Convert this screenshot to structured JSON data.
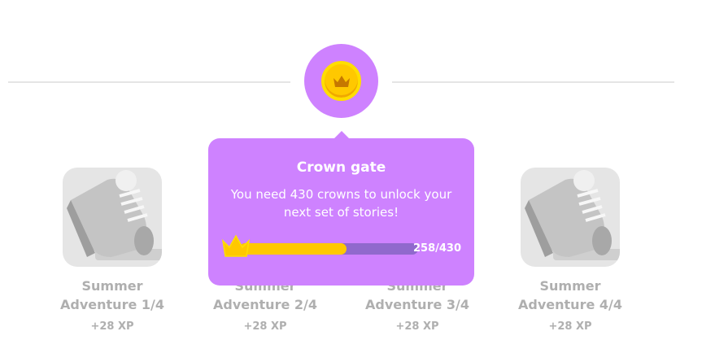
{
  "gate": {
    "title": "Crown gate",
    "message": "You need 430 crowns to unlock your next set of stories!",
    "progress_text": "258/430",
    "current": 258,
    "required": 430
  },
  "stories": [
    {
      "title": "Summer Adventure 1/4",
      "xp": "+28 XP",
      "icon": "sneaker-icon"
    },
    {
      "title": "Summer Adventure 2/4",
      "xp": "+28 XP",
      "icon": "sneaker-icon"
    },
    {
      "title": "Summer Adventure 3/4",
      "xp": "+28 XP",
      "icon": "sneaker-icon"
    },
    {
      "title": "Summer Adventure 4/4",
      "xp": "+28 XP",
      "icon": "sneaker-icon"
    }
  ],
  "colors": {
    "purple": "#ce82ff",
    "gold": "#ffc800",
    "track": "#9069cd",
    "gray": "#afafaf"
  }
}
